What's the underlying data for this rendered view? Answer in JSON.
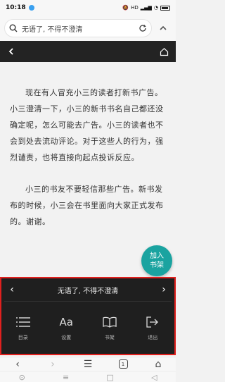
{
  "status": {
    "time": "10:18",
    "network": "HD",
    "battery_level": 0.7
  },
  "search": {
    "text": "无语了, 不得不澄清"
  },
  "reader": {
    "paragraphs": [
      "现在有人冒充小三的读者打新书广告。小三澄清一下，小三的新书书名自己都还没确定呢，怎么可能去广告。小三的读者也不会到处去流动评论。对于这些人的行为，强烈谴责，也将直接向起点投诉反应。",
      "小三的书友不要轻信那些广告。新书发布的时候，小三会在书里面向大家正式发布的。谢谢。"
    ],
    "fab_label": "加入书架",
    "chapter_title": "无语了, 不得不澄清",
    "tools": [
      {
        "label": "目录",
        "icon": "list-icon"
      },
      {
        "label": "设置",
        "icon": "font-settings-icon"
      },
      {
        "label": "书架",
        "icon": "book-icon"
      },
      {
        "label": "退出",
        "icon": "exit-icon"
      }
    ]
  },
  "browser": {
    "tab_count": "1"
  },
  "colors": {
    "accent": "#1aa3a0",
    "highlight": "#e0201e",
    "panel_bg": "#1f1f1f"
  }
}
